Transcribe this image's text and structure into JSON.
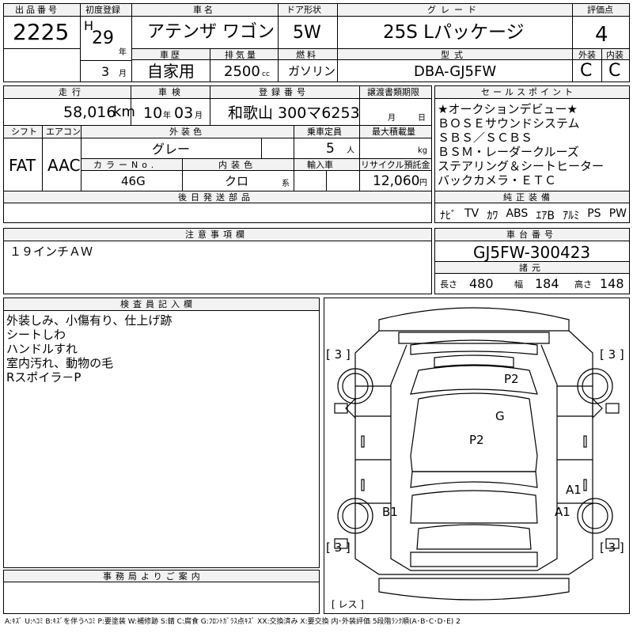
{
  "head": {
    "lot_label": "出品番号",
    "lot": "2225",
    "first_reg_label": "初度登録",
    "era": "H",
    "year": "29",
    "year_unit": "年",
    "month": "3",
    "month_unit": "月",
    "car_name_label": "車名",
    "car_name": "アテンザ ワゴン",
    "door_label": "ドア形状",
    "door": "5W",
    "grade_label": "グレード",
    "grade": "25S Lパッケージ",
    "score_label": "評価点",
    "score": "4",
    "history_label": "車歴",
    "history": "自家用",
    "disp_label": "排気量",
    "disp": "2500",
    "disp_unit": "cc",
    "fuel_label": "燃料",
    "fuel": "ガソリン",
    "model_label": "型式",
    "model": "DBA-GJ5FW",
    "ext_label": "外装",
    "ext": "C",
    "int_label": "内装",
    "int": "C"
  },
  "row2": {
    "mileage_label": "走行",
    "mileage": "58,016",
    "mileage_unit": "km",
    "inspect_label": "車検",
    "inspect_y": "10",
    "inspect_y_unit": "年",
    "inspect_m": "03",
    "inspect_m_unit": "月",
    "reg_label": "登録番号",
    "reg": "和歌山 300マ6253",
    "transfer_label": "譲渡書類期限",
    "transfer_m": "月",
    "transfer_d": "日",
    "shift_label": "シフト",
    "shift": "FAT",
    "ac_label": "エアコン",
    "ac": "AAC",
    "color_label": "外装色",
    "color": "グレー",
    "capacity_label": "乗車定員",
    "capacity": "5",
    "capacity_unit": "人",
    "load_label": "最大積載量",
    "load_unit": "kg",
    "color_no_label": "カラーNo.",
    "color_no": "46G",
    "int_color_label": "内装色",
    "int_color": "クロ",
    "int_color_unit": "系",
    "import_label": "輸入車",
    "recycle_label": "リサイクル預託金",
    "recycle": "12,060",
    "recycle_unit": "円",
    "later_label": "後日発送部品"
  },
  "sales": {
    "label": "セールスポイント",
    "lines": [
      "★オークションデビュー★",
      "ＢＯＳＥサウンドシステム",
      "ＳＢＳ／ＳＣＢＳ",
      "ＢＳＭ・レーダークルーズ",
      "ステアリング＆シートヒーター",
      "バックカメラ・ＥＴＣ"
    ]
  },
  "equip": {
    "label": "純正装備",
    "items": [
      "ﾅﾋﾞ",
      "TV",
      "ｶﾜ",
      "ABS",
      "ｴｱB",
      "ｱﾙﾐ",
      "PS",
      "PW"
    ]
  },
  "notes": {
    "label": "注意事項欄",
    "text": "１９インチＡＷ"
  },
  "chassis": {
    "label": "車台番号",
    "value": "GJ5FW-300423"
  },
  "dims": {
    "label": "諸元",
    "len_label": "長さ",
    "len": "480",
    "wid_label": "幅",
    "wid": "184",
    "hgt_label": "高さ",
    "hgt": "148"
  },
  "inspector": {
    "label": "検査員記入欄",
    "lines": [
      "外装しみ、小傷有り、仕上げ跡",
      "シートしわ",
      "ハンドルすれ",
      "室内汚れ、動物の毛",
      "Rスポイラ－P"
    ]
  },
  "diagram": {
    "tl": "[ 3 ]",
    "tr": "[ 3 ]",
    "bl": "[ 3 ]",
    "br": "[ 3 ]",
    "spare": "[ レス ]",
    "p2_top": "P2",
    "g": "G",
    "p2_mid": "P2",
    "a1_upper": "A1",
    "b1": "B1",
    "a1_lower": "A1"
  },
  "office": {
    "label": "事務局よりご案内"
  },
  "legend": "A:ｷｽﾞ U:ﾍｺﾐ B:ｷｽﾞを伴うﾍｺﾐ P:要塗装 W:補修跡 S:錆 C:腐食 G:ﾌﾛﾝﾄｶﾞﾗｽ点ｷｽﾞ XX:交換済み X:要交換 内･外装評価 5段階ﾗﾝｸ順(A･B･C･D･E) 2"
}
